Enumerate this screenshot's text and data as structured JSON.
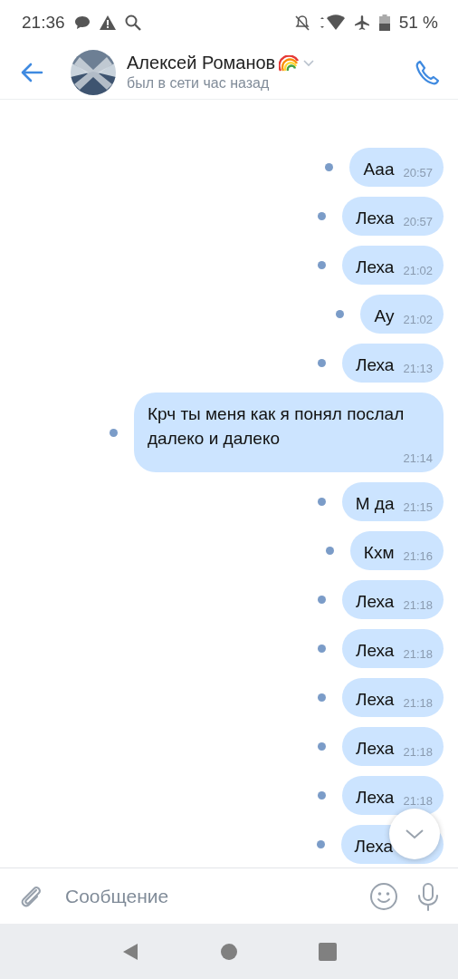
{
  "status_bar": {
    "time": "21:36",
    "battery": "51 %"
  },
  "header": {
    "name": "Алексей Романов",
    "status": "был в сети час назад"
  },
  "messages": [
    {
      "text": "Ааа",
      "time": "20:57",
      "unread": true
    },
    {
      "text": "Леха",
      "time": "20:57",
      "unread": true
    },
    {
      "text": "Леха",
      "time": "21:02",
      "unread": true
    },
    {
      "text": "Ау",
      "time": "21:02",
      "unread": true
    },
    {
      "text": "Леха",
      "time": "21:13",
      "unread": true
    },
    {
      "text": "Крч ты меня как я понял послал далеко и далеко",
      "time": "21:14",
      "unread": true
    },
    {
      "text": "М да",
      "time": "21:15",
      "unread": true
    },
    {
      "text": "Кхм",
      "time": "21:16",
      "unread": true
    },
    {
      "text": "Леха",
      "time": "21:18",
      "unread": true
    },
    {
      "text": "Леха",
      "time": "21:18",
      "unread": true
    },
    {
      "text": "Леха",
      "time": "21:18",
      "unread": true
    },
    {
      "text": "Леха",
      "time": "21:18",
      "unread": true
    },
    {
      "text": "Леха",
      "time": "21:18",
      "unread": true
    },
    {
      "text": "Леха",
      "unread": true
    }
  ],
  "composer": {
    "placeholder": "Сообщение"
  }
}
